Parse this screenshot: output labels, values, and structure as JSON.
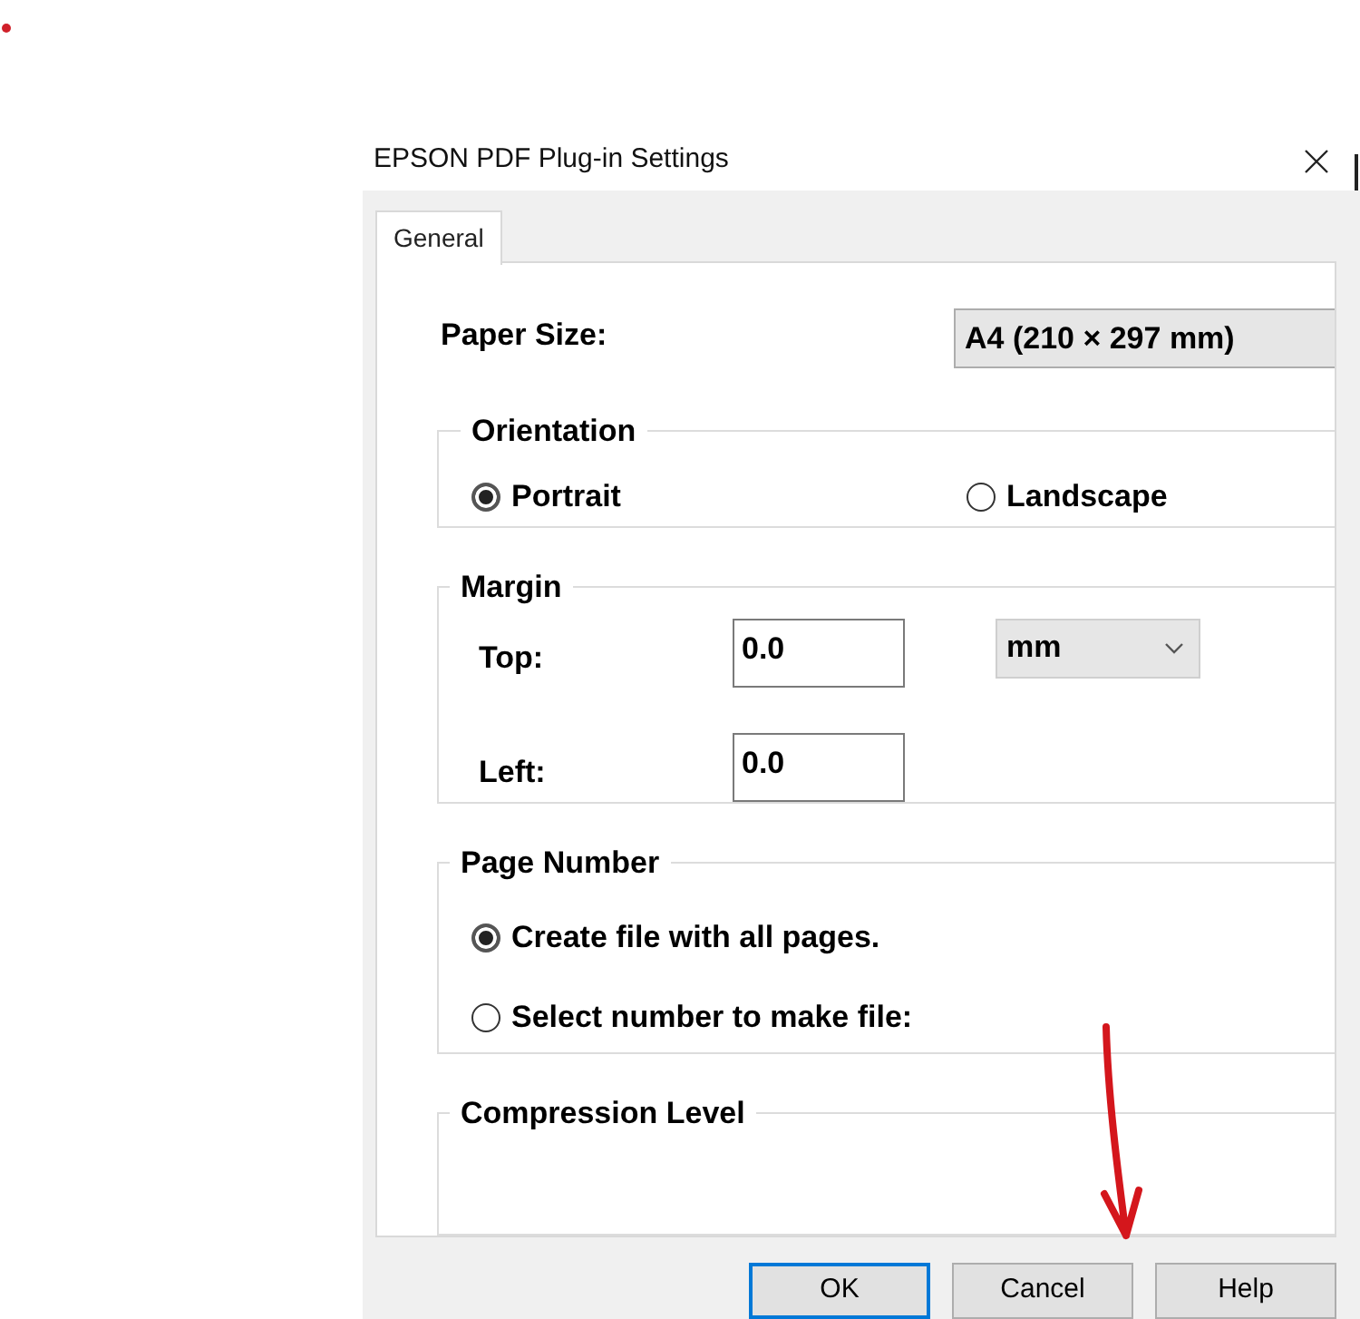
{
  "window": {
    "title": "EPSON PDF Plug-in Settings"
  },
  "tabs": [
    {
      "label": "General",
      "selected": true
    }
  ],
  "paper_size": {
    "label": "Paper Size:",
    "value": "A4 (210 × 297 mm)"
  },
  "orientation": {
    "title": "Orientation",
    "options": [
      {
        "label": "Portrait",
        "selected": true
      },
      {
        "label": "Landscape",
        "selected": false
      }
    ]
  },
  "margin": {
    "title": "Margin",
    "unit": "mm",
    "fields": [
      {
        "label": "Top:",
        "value": "0.0"
      },
      {
        "label": "Left:",
        "value": "0.0"
      }
    ]
  },
  "page_number": {
    "title": "Page Number",
    "options": [
      {
        "label": "Create file with all pages.",
        "selected": true
      },
      {
        "label": "Select number to make file:",
        "selected": false
      }
    ]
  },
  "compression_level": {
    "title": "Compression Level"
  },
  "buttons": [
    {
      "label": "OK",
      "default": true
    },
    {
      "label": "Cancel",
      "default": false
    },
    {
      "label": "Help",
      "default": false
    }
  ]
}
